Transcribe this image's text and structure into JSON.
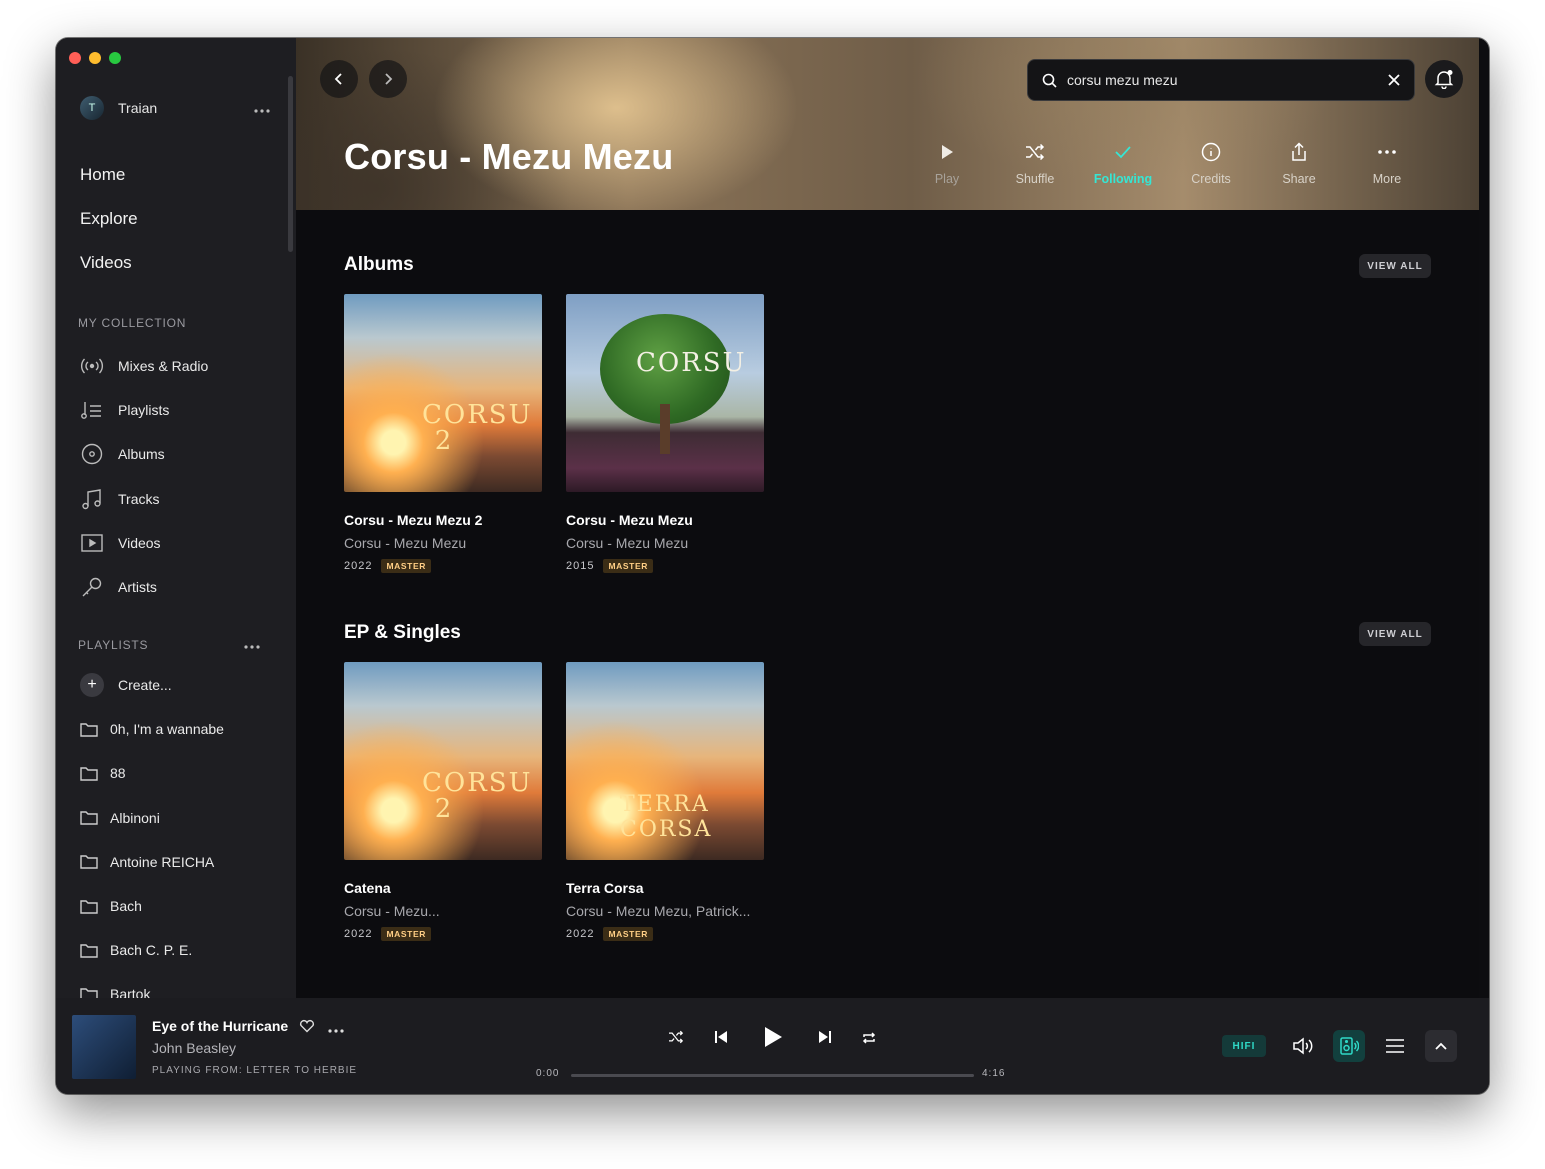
{
  "user": {
    "initial": "T",
    "name": "Traian"
  },
  "nav": [
    "Home",
    "Explore",
    "Videos"
  ],
  "collection": {
    "label": "MY COLLECTION",
    "items": [
      {
        "label": "Mixes & Radio",
        "icon": "radio-icon"
      },
      {
        "label": "Playlists",
        "icon": "playlist-icon"
      },
      {
        "label": "Albums",
        "icon": "album-icon"
      },
      {
        "label": "Tracks",
        "icon": "music-note-icon"
      },
      {
        "label": "Videos",
        "icon": "video-icon"
      },
      {
        "label": "Artists",
        "icon": "microphone-icon"
      }
    ]
  },
  "playlists": {
    "label": "PLAYLISTS",
    "create": "Create...",
    "items": [
      "0h, I'm a wannabe",
      "88",
      "Albinoni",
      "Antoine REICHA",
      "Bach",
      "Bach C. P. E.",
      "Bartok"
    ]
  },
  "search": {
    "value": "corsu mezu mezu"
  },
  "artist": {
    "name": "Corsu - Mezu Mezu"
  },
  "actions": [
    {
      "label": "Play",
      "icon": "play-icon"
    },
    {
      "label": "Shuffle",
      "icon": "shuffle-icon"
    },
    {
      "label": "Following",
      "icon": "check-icon"
    },
    {
      "label": "Credits",
      "icon": "info-icon"
    },
    {
      "label": "Share",
      "icon": "share-icon"
    },
    {
      "label": "More",
      "icon": "more-icon"
    }
  ],
  "sections": {
    "albums": {
      "title": "Albums",
      "view_all": "VIEW ALL",
      "items": [
        {
          "title": "Corsu - Mezu Mezu 2",
          "artist": "Corsu - Mezu Mezu",
          "year": "2022",
          "badge": "MASTER",
          "cover_text": "CORSU 2"
        },
        {
          "title": "Corsu - Mezu Mezu",
          "artist": "Corsu - Mezu Mezu",
          "year": "2015",
          "badge": "MASTER",
          "cover_text": "CORSU"
        }
      ]
    },
    "singles": {
      "title": "EP & Singles",
      "view_all": "VIEW ALL",
      "items": [
        {
          "title": "Catena",
          "artist": "Corsu - Mezu...",
          "year": "2022",
          "badge": "MASTER",
          "cover_text": "CORSU 2"
        },
        {
          "title": "Terra Corsa",
          "artist": "Corsu - Mezu Mezu, Patrick...",
          "year": "2022",
          "badge": "MASTER",
          "cover_text": "TERRA CORSA"
        }
      ]
    }
  },
  "player": {
    "title": "Eye of the Hurricane",
    "artist": "John Beasley",
    "playing_from": "PLAYING FROM: LETTER TO HERBIE",
    "time_current": "0:00",
    "time_total": "4:16",
    "progress": 0.0,
    "quality": "HIFI"
  },
  "colors": {
    "accent": "#35e6d4",
    "badge_text": "#ffcf86",
    "background": "#0c0c0f",
    "sidebar": "#1e1e22"
  }
}
